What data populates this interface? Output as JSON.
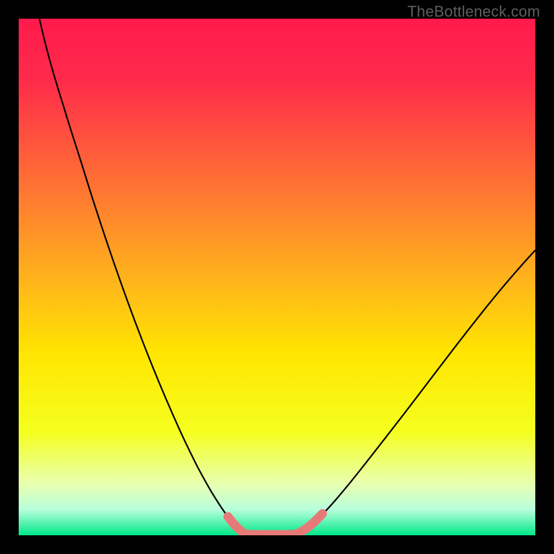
{
  "watermark": "TheBottleneck.com",
  "chart_data": {
    "type": "line",
    "title": "",
    "xlabel": "",
    "ylabel": "",
    "xlim": [
      0,
      100
    ],
    "ylim": [
      0,
      100
    ],
    "grid": false,
    "legend": false,
    "gradient_stops": [
      {
        "offset": 0.0,
        "color": "#ff1a4d"
      },
      {
        "offset": 0.12,
        "color": "#ff2b4a"
      },
      {
        "offset": 0.3,
        "color": "#ff6a36"
      },
      {
        "offset": 0.5,
        "color": "#ffb21c"
      },
      {
        "offset": 0.65,
        "color": "#ffe600"
      },
      {
        "offset": 0.8,
        "color": "#f5ff1f"
      },
      {
        "offset": 0.9,
        "color": "#e8ffb0"
      },
      {
        "offset": 0.95,
        "color": "#b8ffdc"
      },
      {
        "offset": 1.0,
        "color": "#00e888"
      }
    ],
    "series": [
      {
        "name": "left-curve",
        "stroke": "#000000",
        "width": 2.2,
        "points": [
          {
            "x": 4.0,
            "y": 100.0
          },
          {
            "x": 6.0,
            "y": 92.0
          },
          {
            "x": 9.0,
            "y": 82.0
          },
          {
            "x": 12.0,
            "y": 72.5
          },
          {
            "x": 15.0,
            "y": 63.0
          },
          {
            "x": 18.0,
            "y": 54.0
          },
          {
            "x": 21.0,
            "y": 45.5
          },
          {
            "x": 24.0,
            "y": 37.5
          },
          {
            "x": 27.0,
            "y": 30.0
          },
          {
            "x": 30.0,
            "y": 23.0
          },
          {
            "x": 33.0,
            "y": 16.5
          },
          {
            "x": 36.0,
            "y": 10.7
          },
          {
            "x": 38.5,
            "y": 6.5
          },
          {
            "x": 40.5,
            "y": 3.6
          },
          {
            "x": 42.0,
            "y": 1.8
          },
          {
            "x": 43.2,
            "y": 0.7
          },
          {
            "x": 44.0,
            "y": 0.25
          }
        ]
      },
      {
        "name": "floor",
        "stroke": "#000000",
        "width": 2.2,
        "points": [
          {
            "x": 44.0,
            "y": 0.25
          },
          {
            "x": 53.5,
            "y": 0.25
          }
        ]
      },
      {
        "name": "right-curve",
        "stroke": "#000000",
        "width": 2.2,
        "points": [
          {
            "x": 53.5,
            "y": 0.25
          },
          {
            "x": 55.0,
            "y": 0.9
          },
          {
            "x": 57.0,
            "y": 2.4
          },
          {
            "x": 59.5,
            "y": 4.8
          },
          {
            "x": 62.5,
            "y": 8.2
          },
          {
            "x": 66.0,
            "y": 12.5
          },
          {
            "x": 70.0,
            "y": 17.6
          },
          {
            "x": 74.5,
            "y": 23.4
          },
          {
            "x": 79.0,
            "y": 29.3
          },
          {
            "x": 83.5,
            "y": 35.2
          },
          {
            "x": 88.0,
            "y": 41.0
          },
          {
            "x": 92.5,
            "y": 46.6
          },
          {
            "x": 96.5,
            "y": 51.3
          },
          {
            "x": 100.0,
            "y": 55.2
          }
        ]
      },
      {
        "name": "highlight-band",
        "stroke": "#e77a79",
        "width": 13,
        "linecap": "round",
        "points": [
          {
            "x": 40.5,
            "y": 3.6
          },
          {
            "x": 42.0,
            "y": 1.8
          },
          {
            "x": 43.2,
            "y": 0.7
          },
          {
            "x": 44.0,
            "y": 0.25
          },
          {
            "x": 46.0,
            "y": 0.15
          },
          {
            "x": 49.0,
            "y": 0.15
          },
          {
            "x": 52.0,
            "y": 0.15
          },
          {
            "x": 53.5,
            "y": 0.25
          },
          {
            "x": 55.0,
            "y": 0.9
          },
          {
            "x": 57.0,
            "y": 2.4
          },
          {
            "x": 58.8,
            "y": 4.2
          }
        ]
      }
    ]
  }
}
